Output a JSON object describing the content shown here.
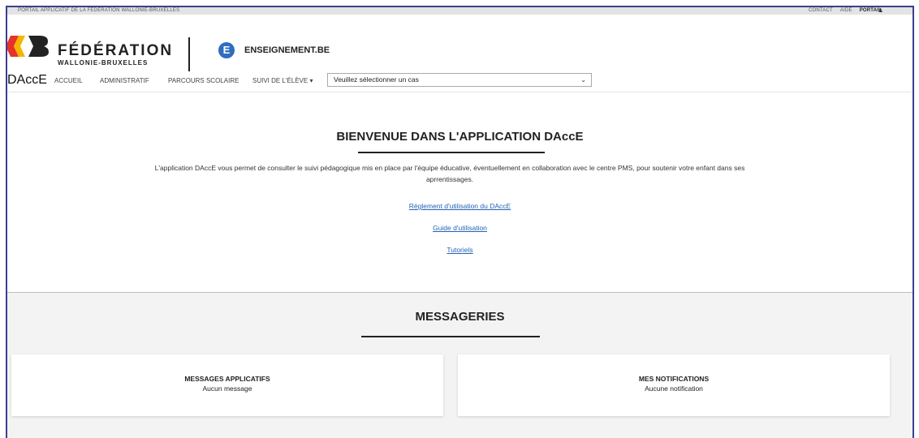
{
  "topbar": {
    "portal_label": "PORTAIL APPLICATIF DE LA FÉDÉRATION WALLONIE-BRUXELLES",
    "links": [
      "CONTACT",
      "AIDE",
      "PORTAIL"
    ]
  },
  "header": {
    "fwb_line1": "FÉDÉRATION",
    "fwb_line2": "WALLONIE-BRUXELLES",
    "ens_badge": "E",
    "ens_text": "ENSEIGNEMENT.BE"
  },
  "nav": {
    "brand": "DAccE",
    "items": [
      "ACCUEIL",
      "ADMINISTRATIF",
      "PARCOURS SCOLAIRE",
      "SUIVI DE L'ÉLÈVE ▾"
    ],
    "select_value": "Veuillez sélectionner un cas"
  },
  "welcome": {
    "title": "BIENVENUE DANS L'APPLICATION DAccE",
    "description": "L'application DAccE vous permet de consulter le suivi pédagogique mis en place par l'équipe éducative, éventuellement en collaboration avec le centre PMS, pour soutenir votre enfant dans ses aprrentissages.",
    "links": [
      "Règlement d'utilisation du DAccE",
      "Guide d'utilisation",
      "Tutoriels"
    ]
  },
  "messaging": {
    "title": "MESSAGERIES",
    "cards": [
      {
        "title": "MESSAGES APPLICATIFS",
        "value": "Aucun message"
      },
      {
        "title": "MES NOTIFICATIONS",
        "value": "Aucune notification"
      }
    ]
  },
  "colors": {
    "accent_blue": "#2f6dbd",
    "link_blue": "#2563b5",
    "frame": "#3b3f8f"
  }
}
